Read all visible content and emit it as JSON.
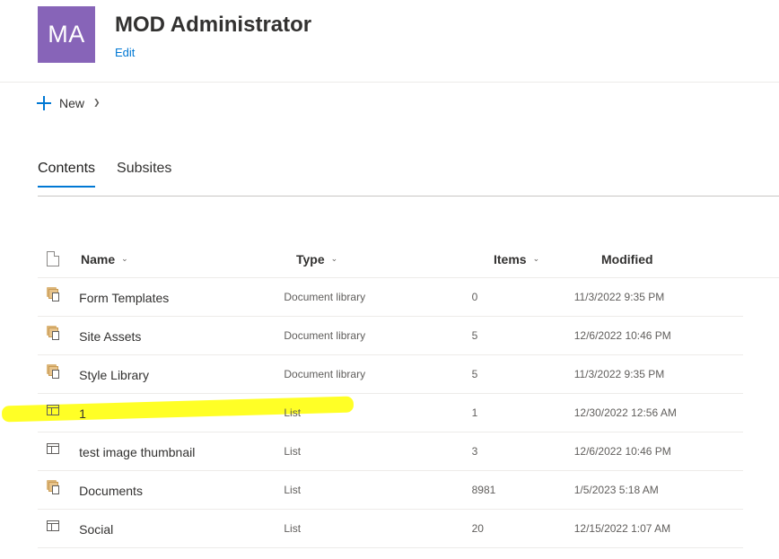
{
  "site": {
    "avatar_initials": "MA",
    "avatar_color": "#8764b8",
    "title": "MOD Administrator",
    "edit_label": "Edit"
  },
  "command_bar": {
    "new_label": "New",
    "new_icon": "plus-icon"
  },
  "tabs": [
    {
      "label": "Contents",
      "active": true
    },
    {
      "label": "Subsites",
      "active": false
    }
  ],
  "table": {
    "columns": {
      "icon": "file-type-icon",
      "name": "Name",
      "type": "Type",
      "items": "Items",
      "modified": "Modified"
    },
    "rows": [
      {
        "icon": "document-library-icon",
        "name": "Form Templates",
        "type": "Document library",
        "items": "0",
        "modified": "11/3/2022 9:35 PM"
      },
      {
        "icon": "document-library-icon",
        "name": "Site Assets",
        "type": "Document library",
        "items": "5",
        "modified": "12/6/2022 10:46 PM"
      },
      {
        "icon": "document-library-icon",
        "name": "Style Library",
        "type": "Document library",
        "items": "5",
        "modified": "11/3/2022 9:35 PM"
      },
      {
        "icon": "list-icon",
        "name": "1",
        "type": "List",
        "items": "1",
        "modified": "12/30/2022 12:56 AM"
      },
      {
        "icon": "list-icon",
        "name": "test image thumbnail",
        "type": "List",
        "items": "3",
        "modified": "12/6/2022 10:46 PM"
      },
      {
        "icon": "document-library-icon",
        "name": "Documents",
        "type": "List",
        "items": "8981",
        "modified": "1/5/2023 5:18 AM"
      },
      {
        "icon": "list-icon",
        "name": "Social",
        "type": "List",
        "items": "20",
        "modified": "12/15/2022 1:07 AM"
      }
    ]
  },
  "colors": {
    "accent": "#0078d4",
    "highlight_marker": "#ffff00"
  }
}
